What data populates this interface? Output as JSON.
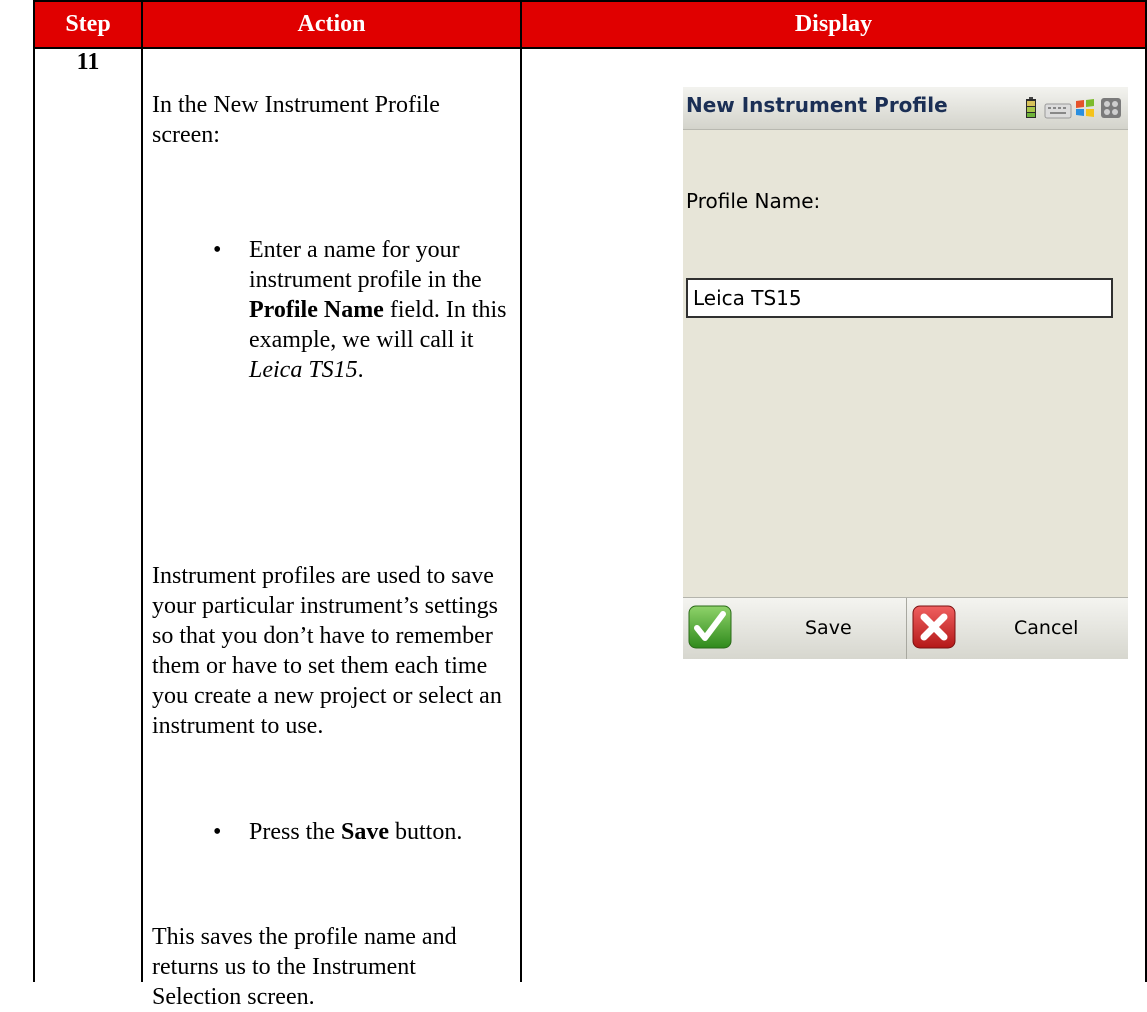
{
  "table": {
    "headers": {
      "step": "Step",
      "action": "Action",
      "display": "Display"
    },
    "step_number": "11",
    "action": {
      "intro": "In the New Instrument Profile screen:",
      "bullet1_pre": "Enter a name for your instrument profile in the",
      "bullet1_bold": "Profile Name",
      "bullet1_mid": "field.  In this example, we will call it",
      "bullet1_italic": "Leica TS15",
      "bullet1_end": ".",
      "paragraph": "Instrument profiles are used to save your particular instrument’s settings so that you don’t have to remember them or have to set them each time you create a new project or select an instrument to use.",
      "bullet2_pre": "Press the",
      "bullet2_bold": "Save",
      "bullet2_end": "button.",
      "closing": "This saves the profile name and returns us to the Instrument Selection screen.",
      "bullet_glyph": "•"
    }
  },
  "device": {
    "title": "New Instrument Profile",
    "status_icons": [
      "battery-icon",
      "keyboard-icon",
      "windows-flag-icon",
      "close-all-icon"
    ],
    "profile_label": "Profile Name:",
    "profile_value": "Leica TS15",
    "save_label": "Save",
    "cancel_label": "Cancel",
    "colors": {
      "header_red": "#e00000",
      "screen_bg": "#e7e5d8",
      "title_text": "#1b2f55"
    }
  }
}
